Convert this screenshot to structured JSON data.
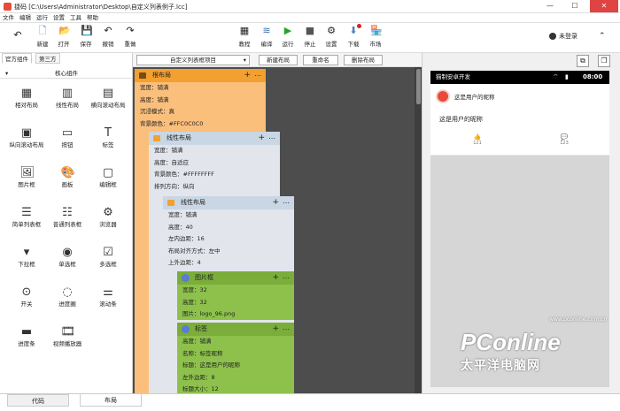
{
  "window": {
    "title": "捷码 [C:\\Users\\Administrator\\Desktop\\自定义列表例子.lcc]",
    "minimize": "—",
    "maximize": "☐",
    "close": "✕"
  },
  "menu": [
    "文件",
    "编辑",
    "运行",
    "设置",
    "工具",
    "帮助"
  ],
  "toolbar": {
    "items": [
      {
        "label": "返回",
        "icon": "↶",
        "show_label": false
      },
      {
        "label": "新建",
        "icon": "🗋",
        "show_label": true
      },
      {
        "label": "打开",
        "icon": "📂",
        "show_label": true
      },
      {
        "label": "保存",
        "icon": "💾",
        "show_label": true
      },
      {
        "label": "撤销",
        "icon": "↶",
        "show_label": true
      },
      {
        "label": "重做",
        "icon": "↷",
        "show_label": true
      },
      {
        "label": "教程",
        "icon": "▦",
        "show_label": true
      },
      {
        "label": "编译",
        "icon": "≋",
        "show_label": true
      },
      {
        "label": "运行",
        "icon": "▶",
        "show_label": true
      },
      {
        "label": "停止",
        "icon": "■",
        "show_label": true
      },
      {
        "label": "设置",
        "icon": "⚙",
        "show_label": true
      },
      {
        "label": "下载",
        "icon": "⬇",
        "show_label": true
      },
      {
        "label": "市场",
        "icon": "🏪",
        "show_label": true
      }
    ],
    "user": "未登录",
    "colors": {
      "run": "#2aa22a",
      "download": "#e02020"
    }
  },
  "left_panel": {
    "tabs": [
      "官方组件",
      "第三方"
    ],
    "section": "核心组件",
    "components": [
      {
        "label": "相对布局",
        "icon": "▦"
      },
      {
        "label": "线性布局",
        "icon": "▥"
      },
      {
        "label": "横向滚动布局",
        "icon": "▤"
      },
      {
        "label": "纵向滚动布局",
        "icon": "▣"
      },
      {
        "label": "按钮",
        "icon": "▭"
      },
      {
        "label": "标签",
        "icon": "T"
      },
      {
        "label": "图片框",
        "icon": "🖼"
      },
      {
        "label": "画板",
        "icon": "🎨"
      },
      {
        "label": "编辑框",
        "icon": "▢"
      },
      {
        "label": "简单列表框",
        "icon": "☰"
      },
      {
        "label": "普通列表框",
        "icon": "☷"
      },
      {
        "label": "浏览器",
        "icon": "⚙"
      },
      {
        "label": "下拉框",
        "icon": "▾"
      },
      {
        "label": "单选框",
        "icon": "◉"
      },
      {
        "label": "多选框",
        "icon": "☑"
      },
      {
        "label": "开关",
        "icon": "⊙"
      },
      {
        "label": "进度圈",
        "icon": "◌"
      },
      {
        "label": "滚动条",
        "icon": "⚌"
      },
      {
        "label": "进度条",
        "icon": "▬"
      },
      {
        "label": "视频播放器",
        "icon": "🎞"
      }
    ]
  },
  "design": {
    "selector": "自定义列表框项目",
    "buttons": [
      "新建布局",
      "重命名",
      "删除布局"
    ],
    "cards": [
      {
        "title": "根布局",
        "rows": [
          "宽度：铺满",
          "高度：铺满",
          "沉浸模式：真",
          "背景颜色：#FFC0C0C0"
        ]
      },
      {
        "title": "线性布局",
        "rows": [
          "宽度：铺满",
          "高度：自适应",
          "背景颜色：#FFFFFFFF",
          "排列方向：纵向"
        ]
      },
      {
        "title": "线性布局",
        "rows": [
          "宽度：铺满",
          "高度：40",
          "左内边距：16",
          "布局对齐方式：左中",
          "上外边距：4"
        ]
      },
      {
        "title": "图片框",
        "rows": [
          "宽度：32",
          "高度：32",
          "图片：logo_96.png"
        ]
      },
      {
        "title": "标签",
        "rows": [
          "高度：铺满",
          "名称：标签昵称",
          "标题：这是用户的昵称",
          "左外边距：8",
          "标题大小：12"
        ]
      }
    ],
    "card_colors": {
      "root": "#fbbf7c",
      "root_head": "#f4a030",
      "linear": "#e2e6ec",
      "linear_head": "#c9d6e3",
      "green": "#8dc14c",
      "green_head": "#7aad3a"
    }
  },
  "preview": {
    "status_app": "猫制安卓开发",
    "status_time": "08:00",
    "nickname_top": "这是用户的昵称",
    "nickname_body": "这是用户的昵称",
    "like_count": "121",
    "comment_count": "123",
    "like_icon": "👍",
    "comment_icon": "💬",
    "logo_color": "#e84a3a"
  },
  "bottom_tabs": [
    "代码",
    "布局"
  ],
  "watermark": {
    "brand": "PConline",
    "sub": "太平洋电脑网",
    "url": "www.pconline.com.cn"
  }
}
